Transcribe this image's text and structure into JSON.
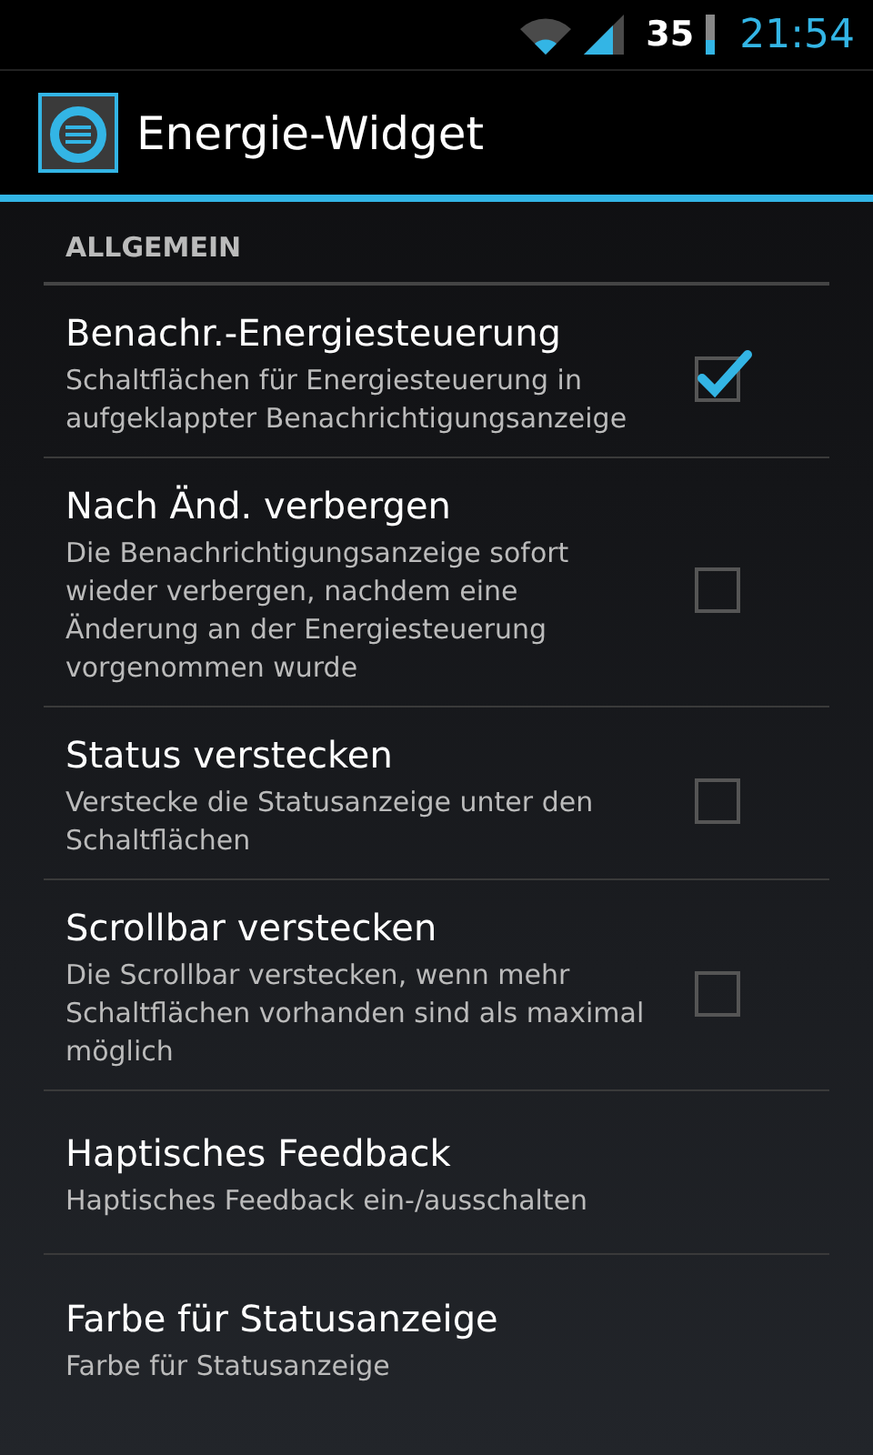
{
  "status_bar": {
    "battery_percent": "35",
    "time": "21:54"
  },
  "action_bar": {
    "title": "Energie-Widget"
  },
  "section": {
    "title": "ALLGEMEIN"
  },
  "preferences": [
    {
      "kind": "checkbox",
      "title": "Benachr.-Energiesteuerung",
      "summary": "Schaltflächen für Energiesteuerung in aufgeklappter Benachrichtigungsanzeige",
      "checked": true
    },
    {
      "kind": "checkbox",
      "title": "Nach Änd. verbergen",
      "summary": "Die Benachrichtigungsanzeige sofort wieder verbergen, nachdem eine Änderung an der Energiesteuerung vorgenommen wurde",
      "checked": false
    },
    {
      "kind": "checkbox",
      "title": "Status verstecken",
      "summary": "Verstecke die Statusanzeige unter den Schaltflächen",
      "checked": false
    },
    {
      "kind": "checkbox",
      "title": "Scrollbar verstecken",
      "summary": "Die Scrollbar verstecken, wenn mehr Schaltflächen vorhanden sind als maximal möglich",
      "checked": false
    },
    {
      "kind": "plain",
      "title": "Haptisches Feedback",
      "summary": "Haptisches Feedback ein-/ausschalten"
    },
    {
      "kind": "plain",
      "title": "Farbe für Statusanzeige",
      "summary": "Farbe für Statusanzeige"
    }
  ]
}
